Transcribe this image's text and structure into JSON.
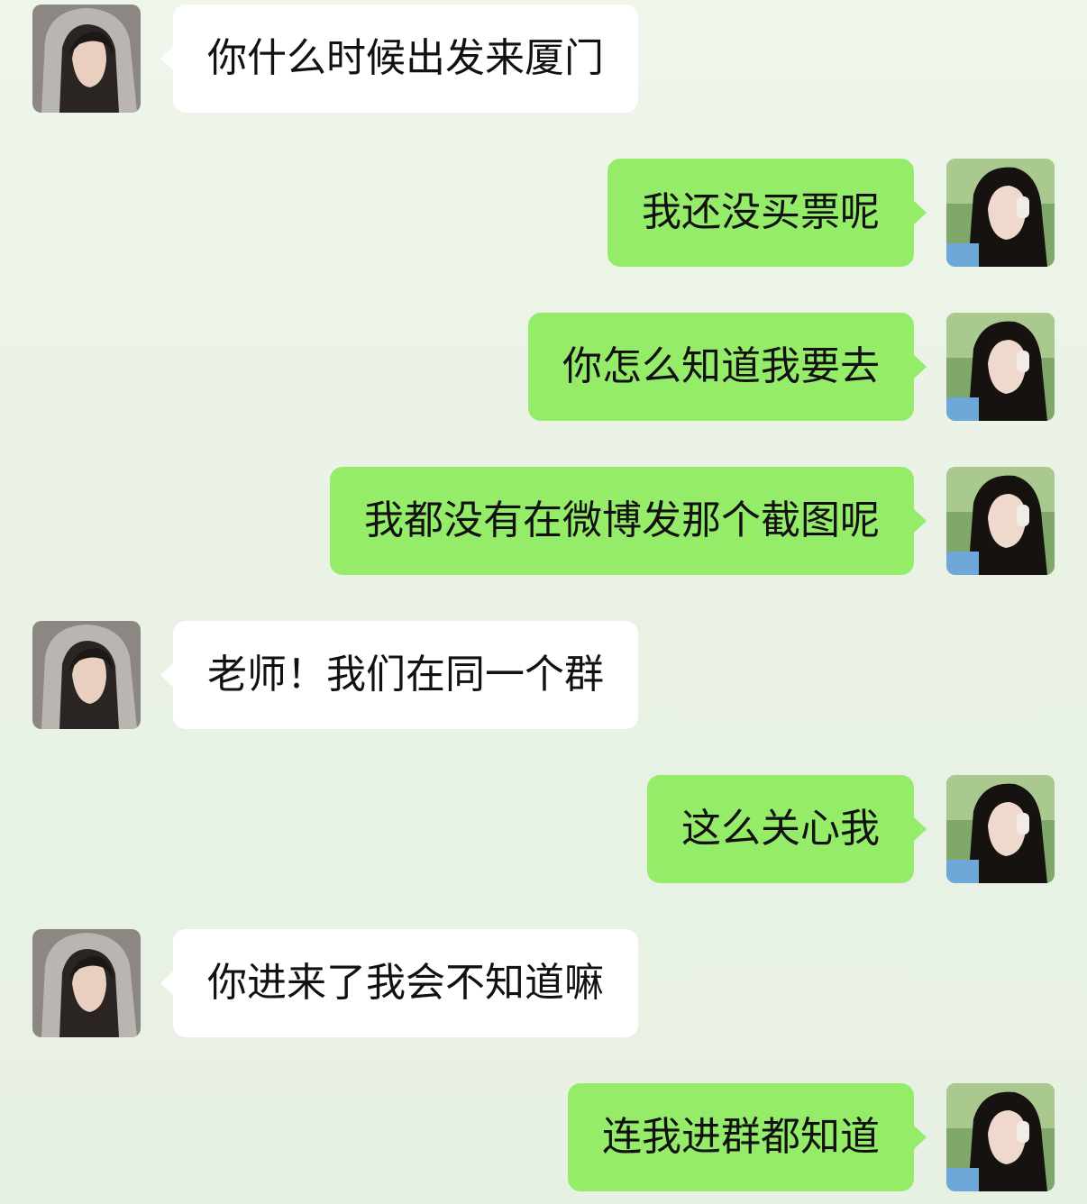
{
  "messages": [
    {
      "side": "left",
      "text": "你什么时候出发来厦门"
    },
    {
      "side": "right",
      "text": "我还没买票呢"
    },
    {
      "side": "right",
      "text": "你怎么知道我要去"
    },
    {
      "side": "right",
      "text": "我都没有在微博发那个截图呢"
    },
    {
      "side": "left",
      "text": "老师！我们在同一个群"
    },
    {
      "side": "right",
      "text": "这么关心我"
    },
    {
      "side": "left",
      "text": "你进来了我会不知道嘛"
    },
    {
      "side": "right",
      "text": "连我进群都知道"
    }
  ],
  "colors": {
    "background": "#e9f2e5",
    "incoming_bubble": "#ffffff",
    "outgoing_bubble": "#95ec69"
  },
  "icons": {
    "incoming_avatar": "avatar-hooded-girl",
    "outgoing_avatar": "avatar-headphones-girl"
  }
}
